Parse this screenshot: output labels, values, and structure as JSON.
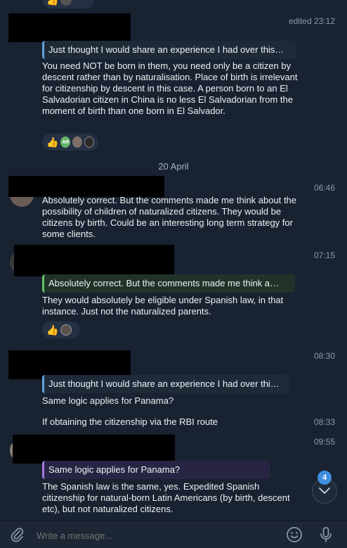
{
  "messages": [
    {
      "time": "edited 23:12",
      "reply": "Just thought I would share an experience I had over this…",
      "text": "You need NOT be born in them, you need only be a citizen by descent rather than by naturalisation. Place of birth is irrelevant for citizenship by descent in this case. A person born to an El Salvadorian citizen in China is no less El Salvadorian from the moment of birth than one born in El Salvador.",
      "reaction_avatar": "AR"
    },
    {
      "time": "06:46",
      "text": "Absolutely correct. But the comments made me think about the possibility of children of naturalized citizens. They would be citizens by birth. Could be an interesting long term strategy for some clients."
    },
    {
      "time": "07:15",
      "reply": "Absolutely correct. But the comments made me think a…",
      "text": "They would absolutely be eligible under Spanish law, in that instance. Just not the naturalized parents."
    },
    {
      "time": "08:30",
      "reply": "Just thought I would share an experience I had over thi…",
      "text": "Same logic applies for Panama?"
    },
    {
      "time": "08:33",
      "text": "If obtaining the citizenship via the RBI route"
    },
    {
      "time": "09:55",
      "reply": "Same logic applies for Panama?",
      "text": "The Spanish law is the same, yes. Expedited Spanish citizenship for natural-born Latin Americans (by birth, descent etc), but not naturalized citizens."
    }
  ],
  "date_separator": "20 April",
  "unread_badge": "4",
  "composer": {
    "placeholder": "Write a message..."
  },
  "icons": {
    "attach": "paperclip-icon",
    "emoji": "smiley-icon",
    "mic": "microphone-icon",
    "scroll": "chevron-down-icon",
    "reaction": "thumbs-up-icon"
  },
  "colors": {
    "background": "#192230",
    "reply_blue": "#5fa2dd",
    "reply_green": "#67c26a",
    "reply_purple": "#a77ae0",
    "badge": "#3f8ee0"
  }
}
